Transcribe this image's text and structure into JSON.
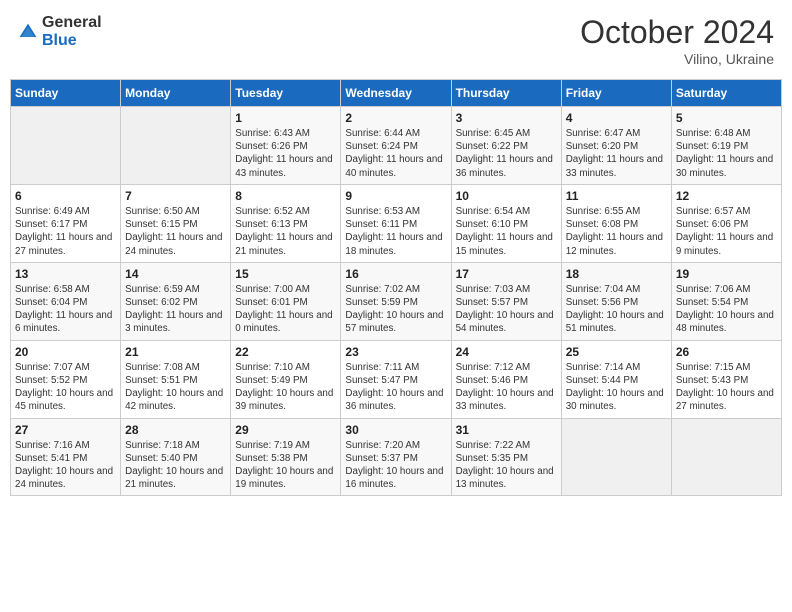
{
  "header": {
    "logo_general": "General",
    "logo_blue": "Blue",
    "month_title": "October 2024",
    "subtitle": "Vilino, Ukraine"
  },
  "days_of_week": [
    "Sunday",
    "Monday",
    "Tuesday",
    "Wednesday",
    "Thursday",
    "Friday",
    "Saturday"
  ],
  "weeks": [
    [
      {
        "day": "",
        "info": ""
      },
      {
        "day": "",
        "info": ""
      },
      {
        "day": "1",
        "info": "Sunrise: 6:43 AM\nSunset: 6:26 PM\nDaylight: 11 hours and 43 minutes."
      },
      {
        "day": "2",
        "info": "Sunrise: 6:44 AM\nSunset: 6:24 PM\nDaylight: 11 hours and 40 minutes."
      },
      {
        "day": "3",
        "info": "Sunrise: 6:45 AM\nSunset: 6:22 PM\nDaylight: 11 hours and 36 minutes."
      },
      {
        "day": "4",
        "info": "Sunrise: 6:47 AM\nSunset: 6:20 PM\nDaylight: 11 hours and 33 minutes."
      },
      {
        "day": "5",
        "info": "Sunrise: 6:48 AM\nSunset: 6:19 PM\nDaylight: 11 hours and 30 minutes."
      }
    ],
    [
      {
        "day": "6",
        "info": "Sunrise: 6:49 AM\nSunset: 6:17 PM\nDaylight: 11 hours and 27 minutes."
      },
      {
        "day": "7",
        "info": "Sunrise: 6:50 AM\nSunset: 6:15 PM\nDaylight: 11 hours and 24 minutes."
      },
      {
        "day": "8",
        "info": "Sunrise: 6:52 AM\nSunset: 6:13 PM\nDaylight: 11 hours and 21 minutes."
      },
      {
        "day": "9",
        "info": "Sunrise: 6:53 AM\nSunset: 6:11 PM\nDaylight: 11 hours and 18 minutes."
      },
      {
        "day": "10",
        "info": "Sunrise: 6:54 AM\nSunset: 6:10 PM\nDaylight: 11 hours and 15 minutes."
      },
      {
        "day": "11",
        "info": "Sunrise: 6:55 AM\nSunset: 6:08 PM\nDaylight: 11 hours and 12 minutes."
      },
      {
        "day": "12",
        "info": "Sunrise: 6:57 AM\nSunset: 6:06 PM\nDaylight: 11 hours and 9 minutes."
      }
    ],
    [
      {
        "day": "13",
        "info": "Sunrise: 6:58 AM\nSunset: 6:04 PM\nDaylight: 11 hours and 6 minutes."
      },
      {
        "day": "14",
        "info": "Sunrise: 6:59 AM\nSunset: 6:02 PM\nDaylight: 11 hours and 3 minutes."
      },
      {
        "day": "15",
        "info": "Sunrise: 7:00 AM\nSunset: 6:01 PM\nDaylight: 11 hours and 0 minutes."
      },
      {
        "day": "16",
        "info": "Sunrise: 7:02 AM\nSunset: 5:59 PM\nDaylight: 10 hours and 57 minutes."
      },
      {
        "day": "17",
        "info": "Sunrise: 7:03 AM\nSunset: 5:57 PM\nDaylight: 10 hours and 54 minutes."
      },
      {
        "day": "18",
        "info": "Sunrise: 7:04 AM\nSunset: 5:56 PM\nDaylight: 10 hours and 51 minutes."
      },
      {
        "day": "19",
        "info": "Sunrise: 7:06 AM\nSunset: 5:54 PM\nDaylight: 10 hours and 48 minutes."
      }
    ],
    [
      {
        "day": "20",
        "info": "Sunrise: 7:07 AM\nSunset: 5:52 PM\nDaylight: 10 hours and 45 minutes."
      },
      {
        "day": "21",
        "info": "Sunrise: 7:08 AM\nSunset: 5:51 PM\nDaylight: 10 hours and 42 minutes."
      },
      {
        "day": "22",
        "info": "Sunrise: 7:10 AM\nSunset: 5:49 PM\nDaylight: 10 hours and 39 minutes."
      },
      {
        "day": "23",
        "info": "Sunrise: 7:11 AM\nSunset: 5:47 PM\nDaylight: 10 hours and 36 minutes."
      },
      {
        "day": "24",
        "info": "Sunrise: 7:12 AM\nSunset: 5:46 PM\nDaylight: 10 hours and 33 minutes."
      },
      {
        "day": "25",
        "info": "Sunrise: 7:14 AM\nSunset: 5:44 PM\nDaylight: 10 hours and 30 minutes."
      },
      {
        "day": "26",
        "info": "Sunrise: 7:15 AM\nSunset: 5:43 PM\nDaylight: 10 hours and 27 minutes."
      }
    ],
    [
      {
        "day": "27",
        "info": "Sunrise: 7:16 AM\nSunset: 5:41 PM\nDaylight: 10 hours and 24 minutes."
      },
      {
        "day": "28",
        "info": "Sunrise: 7:18 AM\nSunset: 5:40 PM\nDaylight: 10 hours and 21 minutes."
      },
      {
        "day": "29",
        "info": "Sunrise: 7:19 AM\nSunset: 5:38 PM\nDaylight: 10 hours and 19 minutes."
      },
      {
        "day": "30",
        "info": "Sunrise: 7:20 AM\nSunset: 5:37 PM\nDaylight: 10 hours and 16 minutes."
      },
      {
        "day": "31",
        "info": "Sunrise: 7:22 AM\nSunset: 5:35 PM\nDaylight: 10 hours and 13 minutes."
      },
      {
        "day": "",
        "info": ""
      },
      {
        "day": "",
        "info": ""
      }
    ]
  ]
}
